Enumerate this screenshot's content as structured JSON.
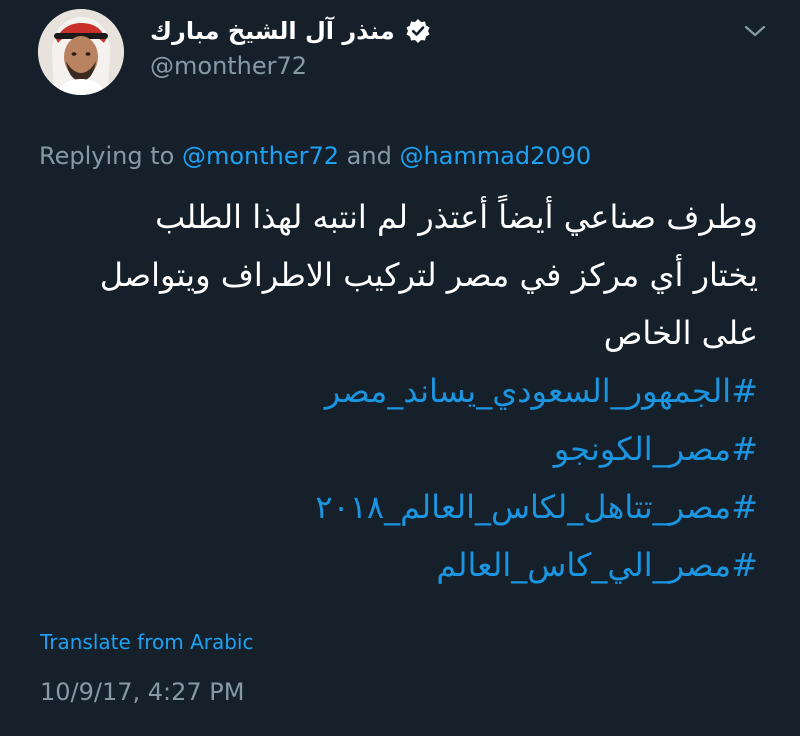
{
  "author": {
    "display_name": "منذر آل الشيخ مبارك",
    "handle": "@monther72",
    "verified_icon": "verified-badge-icon"
  },
  "reply": {
    "prefix": "Replying to",
    "mention_1": "@monther72",
    "joiner": "and",
    "mention_2": "@hammad2090"
  },
  "tweet": {
    "lines": [
      "وطرف صناعي أيضاً أعتذر لم انتبه لهذا الطلب",
      "يختار أي مركز في مصر لتركيب الاطراف ويتواصل",
      "على الخاص"
    ],
    "hashtags": [
      "#الجمهور_السعودي_يساند_مصر",
      "#مصر_الكونجو",
      "#مصر_تتاهل_لكاس_العالم_٢٠١٨",
      "#مصر_الي_كاس_العالم"
    ]
  },
  "translate_label": "Translate from Arabic",
  "timestamp": "10/9/17, 4:27 PM",
  "colors": {
    "background": "#15202b",
    "accent": "#1da1f2",
    "muted": "#8899a6"
  }
}
